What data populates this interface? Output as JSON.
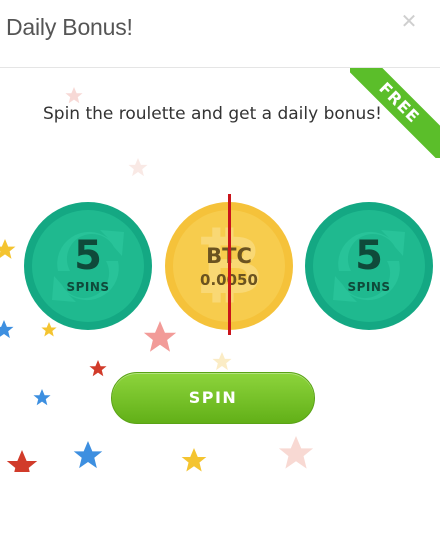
{
  "dialog": {
    "title": "Daily Bonus!",
    "close_icon": "close-icon"
  },
  "main": {
    "subtitle": "Spin the roulette and get a daily bonus!",
    "ribbon_label": "FREE",
    "reel": [
      {
        "kind": "spins",
        "number": "5",
        "label": "SPINS",
        "icon": "refresh-icon"
      },
      {
        "kind": "btc",
        "symbol": "₿",
        "label": "BTC",
        "amount": "0.0050"
      },
      {
        "kind": "spins",
        "number": "5",
        "label": "SPINS",
        "icon": "refresh-icon"
      }
    ],
    "spin_button_label": "SPIN"
  },
  "colors": {
    "accent_green": "#5bbe2a",
    "spins_coin": "#14a883",
    "btc_coin": "#f5c23a",
    "pointer": "#c9141b"
  }
}
